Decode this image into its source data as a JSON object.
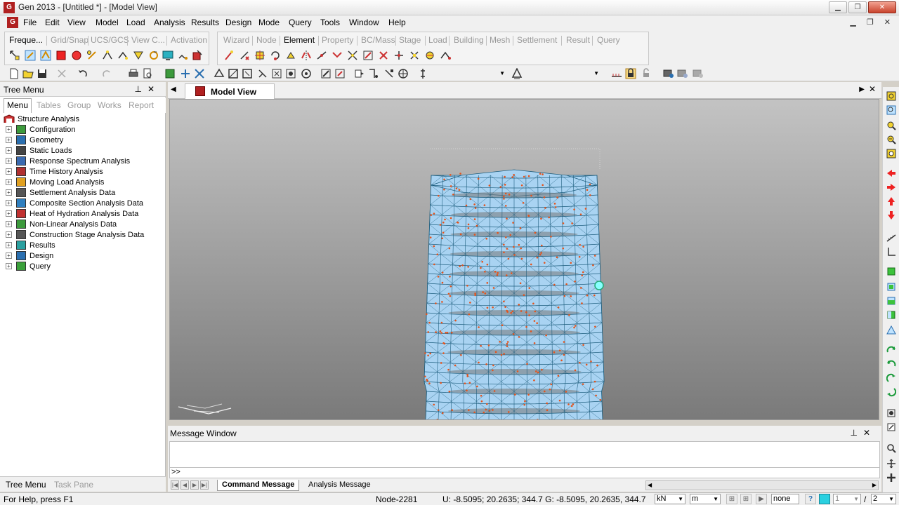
{
  "window": {
    "title": "Gen 2013 - [Untitled *] - [Model View]",
    "app_icon_text": "G",
    "controls": [
      "minimize",
      "restore",
      "close"
    ]
  },
  "menu": [
    "File",
    "Edit",
    "View",
    "Model",
    "Load",
    "Analysis",
    "Results",
    "Design",
    "Mode",
    "Query",
    "Tools",
    "Window",
    "Help"
  ],
  "ribbon": {
    "left_tabs": [
      "Freque...",
      "Grid/Snap",
      "UCS/GCS",
      "View C...",
      "Activation"
    ],
    "right_tabs": [
      "Wizard",
      "Node",
      "Element",
      "Property",
      "BC/Mass",
      "Stage",
      "Load",
      "Building",
      "Mesh",
      "Settlement",
      "Result",
      "Query"
    ],
    "active_right_tab": "Element"
  },
  "tree_panel": {
    "title": "Tree Menu",
    "tabs": [
      "Menu",
      "Tables",
      "Group",
      "Works",
      "Report"
    ],
    "active_tab": "Menu",
    "root": "Structure Analysis",
    "items": [
      {
        "label": "Configuration",
        "icon": "configuration-icon",
        "color": "#3c9a3c"
      },
      {
        "label": "Geometry",
        "icon": "geometry-icon",
        "color": "#2a6fb0"
      },
      {
        "label": "Static Loads",
        "icon": "static-loads-icon",
        "color": "#444444"
      },
      {
        "label": "Response Spectrum Analysis",
        "icon": "response-spectrum-icon",
        "color": "#3a6ab0"
      },
      {
        "label": "Time History Analysis",
        "icon": "time-history-icon",
        "color": "#b03030"
      },
      {
        "label": "Moving Load Analysis",
        "icon": "moving-load-icon",
        "color": "#e0a020"
      },
      {
        "label": "Settlement Analysis Data",
        "icon": "settlement-icon",
        "color": "#555555"
      },
      {
        "label": "Composite Section Analysis Data",
        "icon": "composite-section-icon",
        "color": "#2f7fbf"
      },
      {
        "label": "Heat of Hydration Analysis Data",
        "icon": "heat-hydration-icon",
        "color": "#c03030"
      },
      {
        "label": "Non-Linear Analysis Data",
        "icon": "non-linear-icon",
        "color": "#3c9a3c"
      },
      {
        "label": "Construction Stage Analysis Data",
        "icon": "construction-stage-icon",
        "color": "#555555"
      },
      {
        "label": "Results",
        "icon": "results-icon",
        "color": "#2aa0a0"
      },
      {
        "label": "Design",
        "icon": "design-icon",
        "color": "#2a6fb0"
      },
      {
        "label": "Query",
        "icon": "query-icon",
        "color": "#3aa03a"
      }
    ],
    "bottom_tabs": [
      "Tree Menu",
      "Task Pane"
    ],
    "active_bottom_tab": "Tree Menu"
  },
  "model_view": {
    "tab_label": "Model View"
  },
  "message_window": {
    "title": "Message Window",
    "prompt": ">>",
    "tabs": [
      "Command Message",
      "Analysis Message"
    ],
    "active_tab": "Command Message"
  },
  "status": {
    "help": "For Help, press F1",
    "node": "Node-2281",
    "coords": "U: -8.5095; 20.2635; 344.7  G: -8.5095, 20.2635, 344.7",
    "force_unit": "kN",
    "length_unit": "m",
    "view_mode": "none",
    "page": "1",
    "total_pages": "2",
    "page_sep": "/"
  },
  "colors": {
    "viewport_top": "#c3c3c3",
    "viewport_bottom": "#7a7a7a",
    "mesh_fill": "#a9d3f2",
    "mesh_line": "#1f5f7f",
    "node_dot": "#e4531b"
  }
}
